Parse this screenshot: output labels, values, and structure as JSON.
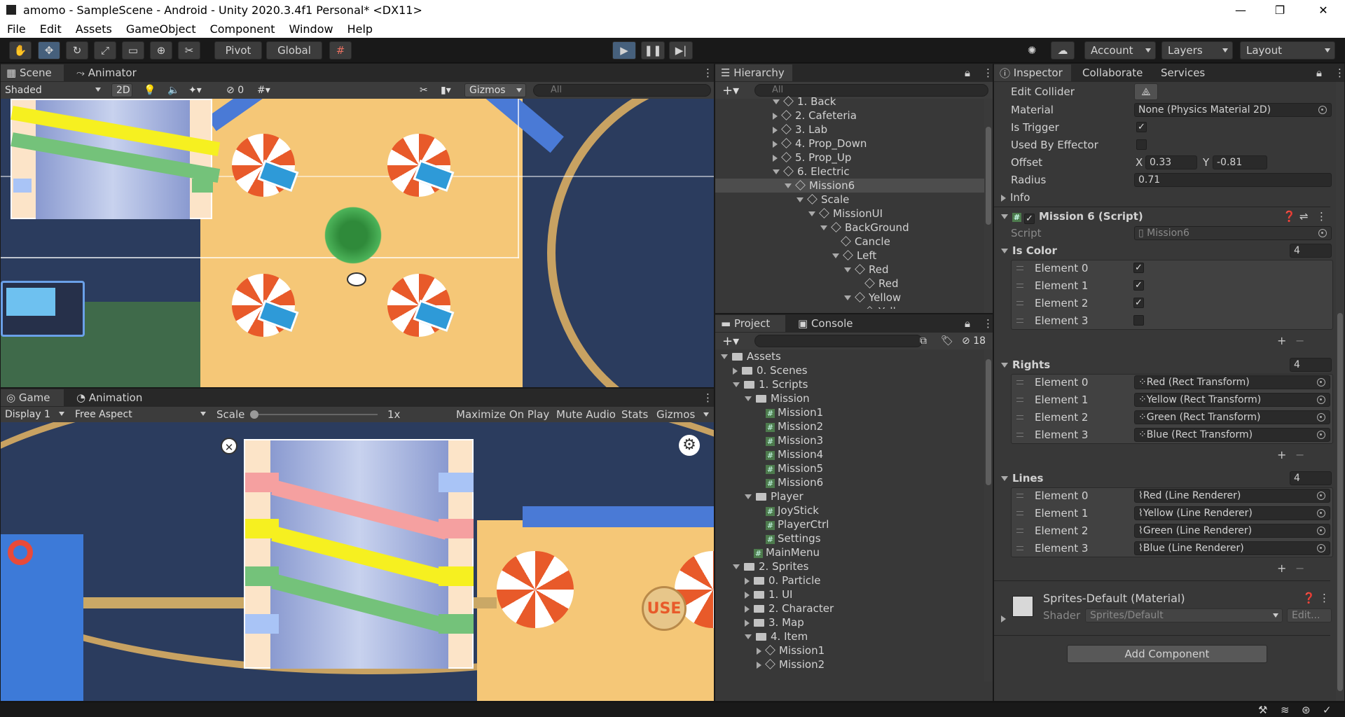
{
  "window": {
    "title": "amomo - SampleScene - Android - Unity 2020.3.4f1 Personal* <DX11>",
    "controls": [
      "—",
      "❐",
      "✕"
    ]
  },
  "menu": [
    "File",
    "Edit",
    "Assets",
    "GameObject",
    "Component",
    "Window",
    "Help"
  ],
  "toolbar": {
    "pivot": "Pivot",
    "global": "Global",
    "account": "Account",
    "layers": "Layers",
    "layout": "Layout"
  },
  "scene": {
    "tabs": [
      "Scene",
      "Animator"
    ],
    "shading": "Shaded",
    "mode2d": "2D",
    "hidden_count": "0",
    "gizmos": "Gizmos",
    "search_placeholder": "All"
  },
  "game": {
    "tabs": [
      "Game",
      "Animation"
    ],
    "display": "Display 1",
    "aspect": "Free Aspect",
    "scale_label": "Scale",
    "scale_value": "1x",
    "maximize": "Maximize On Play",
    "mute": "Mute Audio",
    "stats": "Stats",
    "gizmos": "Gizmos",
    "use_button": "USE"
  },
  "hierarchy": {
    "tab": "Hierarchy",
    "search_placeholder": "All",
    "items": [
      {
        "label": "1. Back",
        "depth": 4,
        "fold": "open",
        "icon": "cube"
      },
      {
        "label": "2. Cafeteria",
        "depth": 4,
        "fold": "closed",
        "icon": "cube"
      },
      {
        "label": "3. Lab",
        "depth": 4,
        "fold": "closed",
        "icon": "cube"
      },
      {
        "label": "4. Prop_Down",
        "depth": 4,
        "fold": "closed",
        "icon": "cube"
      },
      {
        "label": "5. Prop_Up",
        "depth": 4,
        "fold": "closed",
        "icon": "cube"
      },
      {
        "label": "6. Electric",
        "depth": 4,
        "fold": "open",
        "icon": "cube"
      },
      {
        "label": "Mission6",
        "depth": 5,
        "fold": "open",
        "icon": "cube",
        "selected": true
      },
      {
        "label": "Scale",
        "depth": 6,
        "fold": "open",
        "icon": "cube"
      },
      {
        "label": "MissionUI",
        "depth": 7,
        "fold": "open",
        "icon": "cube"
      },
      {
        "label": "BackGround",
        "depth": 8,
        "fold": "open",
        "icon": "cube"
      },
      {
        "label": "Cancle",
        "depth": 9,
        "fold": "none",
        "icon": "cube"
      },
      {
        "label": "Left",
        "depth": 9,
        "fold": "open",
        "icon": "cube"
      },
      {
        "label": "Red",
        "depth": 10,
        "fold": "open",
        "icon": "cube"
      },
      {
        "label": "Red",
        "depth": 11,
        "fold": "none",
        "icon": "cube"
      },
      {
        "label": "Yellow",
        "depth": 10,
        "fold": "open",
        "icon": "cube"
      },
      {
        "label": "Yellow",
        "depth": 11,
        "fold": "none",
        "icon": "cube"
      }
    ]
  },
  "project": {
    "tabs": [
      "Project",
      "Console"
    ],
    "hidden_count": "18",
    "items": [
      {
        "label": "Assets",
        "depth": 0,
        "fold": "open",
        "icon": "folder"
      },
      {
        "label": "0. Scenes",
        "depth": 1,
        "fold": "closed",
        "icon": "folder"
      },
      {
        "label": "1. Scripts",
        "depth": 1,
        "fold": "open",
        "icon": "folder"
      },
      {
        "label": "Mission",
        "depth": 2,
        "fold": "open",
        "icon": "folder"
      },
      {
        "label": "Mission1",
        "depth": 3,
        "fold": "none",
        "icon": "script"
      },
      {
        "label": "Mission2",
        "depth": 3,
        "fold": "none",
        "icon": "script"
      },
      {
        "label": "Mission3",
        "depth": 3,
        "fold": "none",
        "icon": "script"
      },
      {
        "label": "Mission4",
        "depth": 3,
        "fold": "none",
        "icon": "script"
      },
      {
        "label": "Mission5",
        "depth": 3,
        "fold": "none",
        "icon": "script"
      },
      {
        "label": "Mission6",
        "depth": 3,
        "fold": "none",
        "icon": "script"
      },
      {
        "label": "Player",
        "depth": 2,
        "fold": "open",
        "icon": "folder"
      },
      {
        "label": "JoyStick",
        "depth": 3,
        "fold": "none",
        "icon": "script"
      },
      {
        "label": "PlayerCtrl",
        "depth": 3,
        "fold": "none",
        "icon": "script"
      },
      {
        "label": "Settings",
        "depth": 3,
        "fold": "none",
        "icon": "script"
      },
      {
        "label": "MainMenu",
        "depth": 2,
        "fold": "none",
        "icon": "script"
      },
      {
        "label": "2. Sprites",
        "depth": 1,
        "fold": "open",
        "icon": "folder"
      },
      {
        "label": "0. Particle",
        "depth": 2,
        "fold": "closed",
        "icon": "folder"
      },
      {
        "label": "1. UI",
        "depth": 2,
        "fold": "closed",
        "icon": "folder"
      },
      {
        "label": "2. Character",
        "depth": 2,
        "fold": "closed",
        "icon": "folder"
      },
      {
        "label": "3. Map",
        "depth": 2,
        "fold": "closed",
        "icon": "folder"
      },
      {
        "label": "4. Item",
        "depth": 2,
        "fold": "open",
        "icon": "folder"
      },
      {
        "label": "Mission1",
        "depth": 3,
        "fold": "closed",
        "icon": "cube"
      },
      {
        "label": "Mission2",
        "depth": 3,
        "fold": "closed",
        "icon": "cube"
      }
    ]
  },
  "inspector": {
    "tabs": [
      "Inspector",
      "Collaborate",
      "Services"
    ],
    "collider": {
      "edit_collider": "Edit Collider",
      "material_label": "Material",
      "material_value": "None (Physics Material 2D)",
      "is_trigger": "Is Trigger",
      "is_trigger_checked": "✓",
      "used_by_effector": "Used By Effector",
      "offset": "Offset",
      "offset_x_label": "X",
      "offset_x": "0.33",
      "offset_y_label": "Y",
      "offset_y": "-0.81",
      "radius": "Radius",
      "radius_value": "0.71",
      "info": "Info"
    },
    "script_component": {
      "title": "Mission 6 (Script)",
      "script_label": "Script",
      "script_value": "Mission6",
      "is_color": {
        "label": "Is Color",
        "size": "4",
        "elements": [
          {
            "label": "Element 0",
            "value": "✓"
          },
          {
            "label": "Element 1",
            "value": "✓"
          },
          {
            "label": "Element 2",
            "value": "✓"
          },
          {
            "label": "Element 3",
            "value": ""
          }
        ]
      },
      "rights": {
        "label": "Rights",
        "size": "4",
        "elements": [
          {
            "label": "Element 0",
            "value": "Red (Rect Transform)"
          },
          {
            "label": "Element 1",
            "value": "Yellow (Rect Transform)"
          },
          {
            "label": "Element 2",
            "value": "Green (Rect Transform)"
          },
          {
            "label": "Element 3",
            "value": "Blue (Rect Transform)"
          }
        ]
      },
      "lines": {
        "label": "Lines",
        "size": "4",
        "elements": [
          {
            "label": "Element 0",
            "value": "Red (Line Renderer)"
          },
          {
            "label": "Element 1",
            "value": "Yellow (Line Renderer)"
          },
          {
            "label": "Element 2",
            "value": "Green (Line Renderer)"
          },
          {
            "label": "Element 3",
            "value": "Blue (Line Renderer)"
          }
        ]
      }
    },
    "material": {
      "name": "Sprites-Default (Material)",
      "shader_label": "Shader",
      "shader_value": "Sprites/Default",
      "edit": "Edit..."
    },
    "add_component": "Add Component"
  },
  "colors": {
    "accent": "#46607c",
    "selection": "#4d4d4d",
    "sand": "#f5c777",
    "navy": "#2b3c5e"
  }
}
